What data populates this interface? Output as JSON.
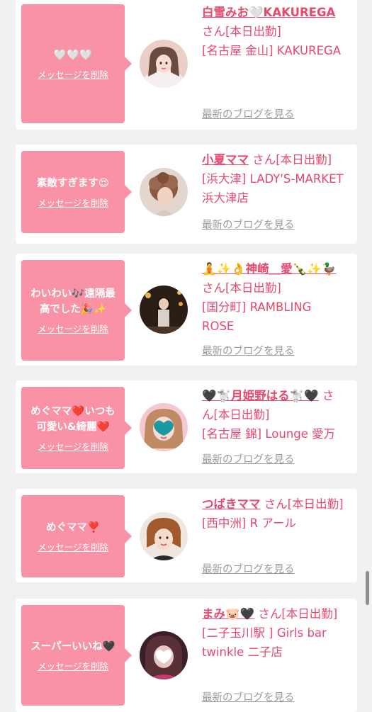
{
  "delete_label": "メッセージを削除",
  "blog_label": "最新のブログを見る",
  "san_suffix": "さん",
  "cards": [
    {
      "message": "🤍🤍🤍",
      "name": "白雪みお🤍KAKUREGA",
      "status": "[本日出勤]",
      "shop": "[名古屋 金山] KAKUREGA",
      "avatar": "avatar-woman-long-hair"
    },
    {
      "message": "素敵すぎます😍",
      "name": "小夏ママ",
      "status": "[本日出勤]",
      "shop": "[浜大津] LADY'S-MARKET 浜大津店",
      "avatar": "avatar-woman-curly-updo"
    },
    {
      "message": "わいわい🎶遠隔最高でした🎉✨",
      "name": "🧘✨👌神崎＿愛🍾✨🦆",
      "status": "[本日出勤]",
      "shop": "[国分町] RAMBLING ROSE",
      "avatar": "avatar-woman-night-street"
    },
    {
      "message": "めぐママ❤️いつも可愛い&綺麗❤️",
      "name": "🖤🐩月姫野はる🐩🖤",
      "status": "[本日出勤]",
      "shop": "[名古屋 錦] Lounge 愛万",
      "avatar": "avatar-woman-heart-sticker"
    },
    {
      "message": "めぐママ❣️",
      "name": "つばきママ",
      "status": "[本日出勤]",
      "shop": "[西中洲] R アール",
      "avatar": "avatar-woman-short-hair"
    },
    {
      "message": "スーパーいいね🖤",
      "name": "まみ🐷🖤",
      "status": "[本日出勤]",
      "shop": "[二子玉川駅 ] Girls bar twinkle 二子店",
      "avatar": "avatar-woman-heart-sticker-dark"
    }
  ]
}
